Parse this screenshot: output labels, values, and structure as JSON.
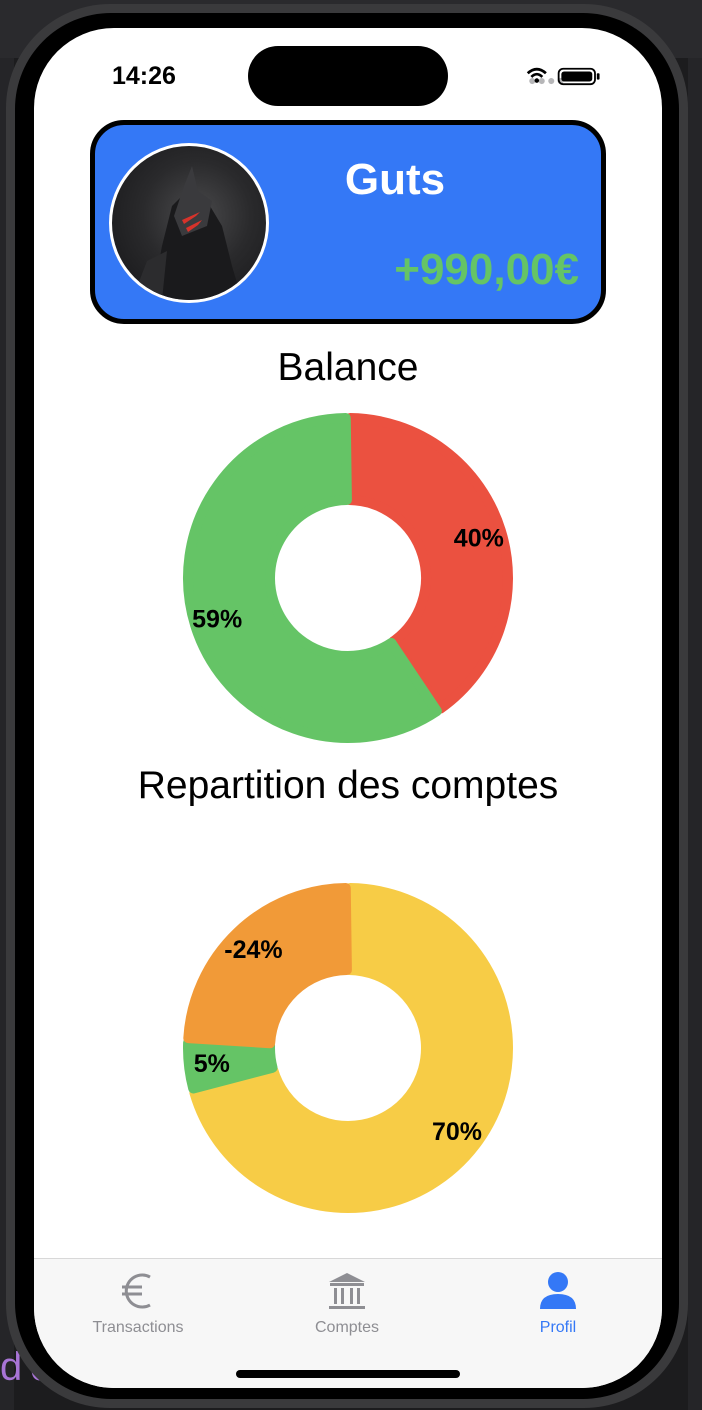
{
  "status_bar": {
    "time": "14:26"
  },
  "profile": {
    "name": "Guts",
    "balance": "+990,00€"
  },
  "balance_section": {
    "title": "Balance"
  },
  "accounts_section": {
    "title": "Repartition des comptes"
  },
  "chart_data": [
    {
      "type": "pie",
      "title": "Balance",
      "series": [
        {
          "label": "40%",
          "value": 40,
          "color": "#eb5140"
        },
        {
          "label": "59%",
          "value": 59,
          "color": "#65c466"
        }
      ]
    },
    {
      "type": "pie",
      "title": "Repartition des comptes",
      "series": [
        {
          "label": "70%",
          "value": 70,
          "color": "#f7cc46"
        },
        {
          "label": "5%",
          "value": 5,
          "color": "#65c466"
        },
        {
          "label": "-24%",
          "value": 24,
          "color": "#f19a38"
        }
      ]
    }
  ],
  "tabbar": {
    "items": [
      {
        "label": "Transactions",
        "icon": "euro-icon",
        "active": false
      },
      {
        "label": "Comptes",
        "icon": "bank-icon",
        "active": false
      },
      {
        "label": "Profil",
        "icon": "person-icon",
        "active": true
      }
    ],
    "active_color": "#3478f6",
    "inactive_color": "#8e8e93"
  }
}
